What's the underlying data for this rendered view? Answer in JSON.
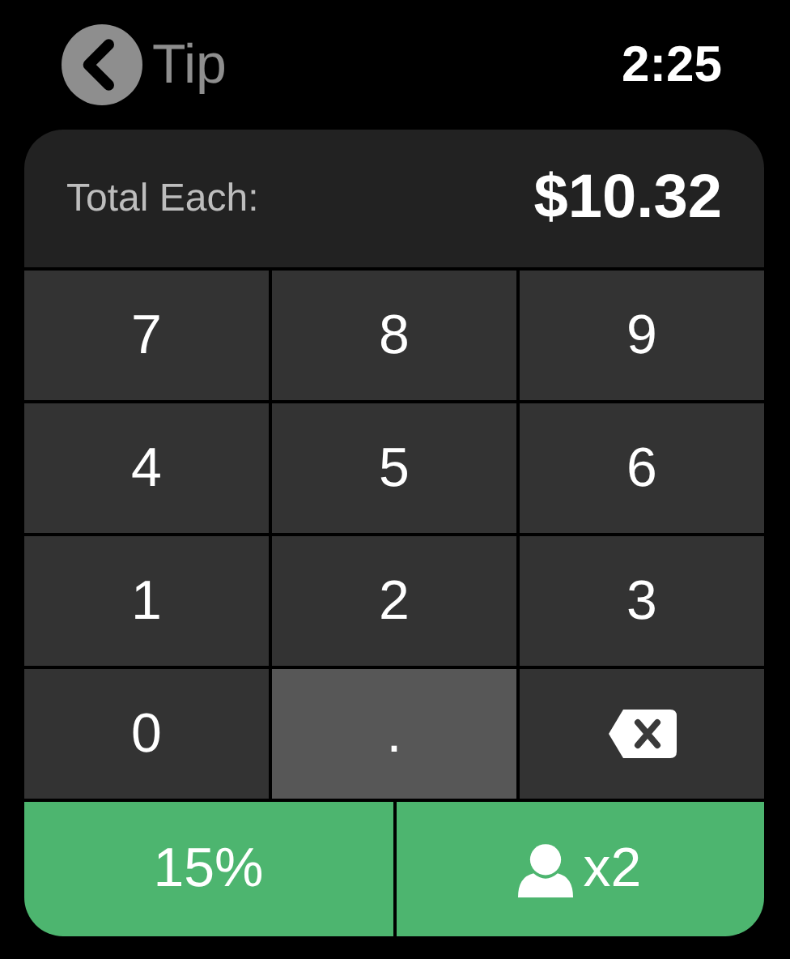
{
  "header": {
    "back_label": "Tip",
    "time": "2:25"
  },
  "total": {
    "label": "Total Each:",
    "value": "$10.32"
  },
  "keys": [
    {
      "kind": "char",
      "label": "7",
      "highlighted": false
    },
    {
      "kind": "char",
      "label": "8",
      "highlighted": false
    },
    {
      "kind": "char",
      "label": "9",
      "highlighted": false
    },
    {
      "kind": "char",
      "label": "4",
      "highlighted": false
    },
    {
      "kind": "char",
      "label": "5",
      "highlighted": false
    },
    {
      "kind": "char",
      "label": "6",
      "highlighted": false
    },
    {
      "kind": "char",
      "label": "1",
      "highlighted": false
    },
    {
      "kind": "char",
      "label": "2",
      "highlighted": false
    },
    {
      "kind": "char",
      "label": "3",
      "highlighted": false
    },
    {
      "kind": "char",
      "label": "0",
      "highlighted": false
    },
    {
      "kind": "char",
      "label": ".",
      "highlighted": true
    },
    {
      "kind": "backspace",
      "highlighted": false
    }
  ],
  "actions": [
    {
      "kind": "text",
      "label": "15%"
    },
    {
      "kind": "people",
      "label": "x2"
    }
  ]
}
